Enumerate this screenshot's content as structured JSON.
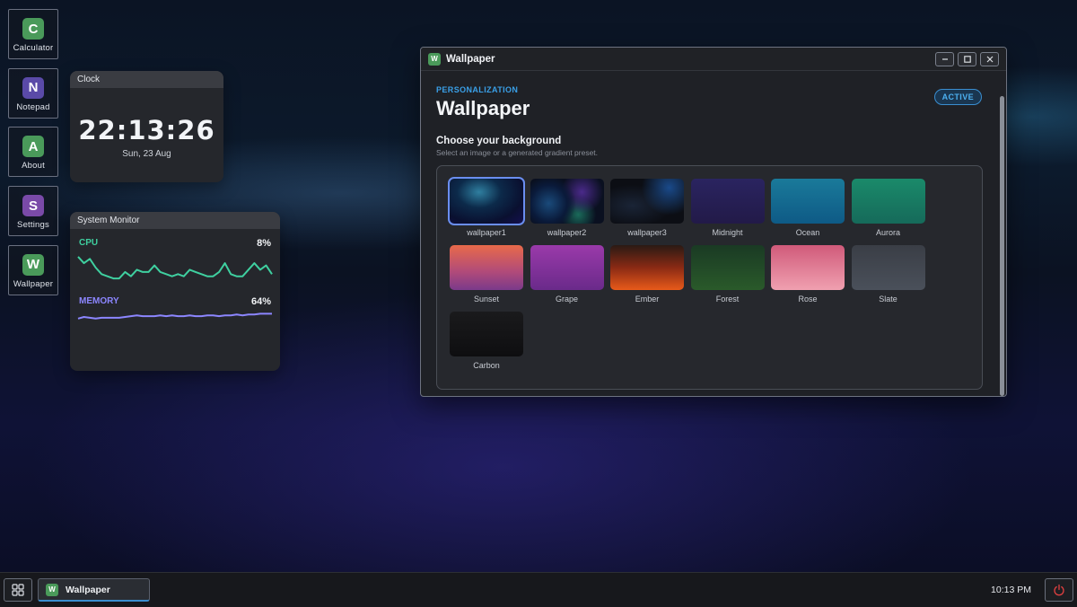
{
  "desktop": {
    "icons": [
      {
        "letter": "C",
        "label": "Calculator",
        "color": "#4a9a5a"
      },
      {
        "letter": "N",
        "label": "Notepad",
        "color": "#5a4aa8"
      },
      {
        "letter": "A",
        "label": "About",
        "color": "#4a9a5a"
      },
      {
        "letter": "S",
        "label": "Settings",
        "color": "#7a4aa8"
      },
      {
        "letter": "W",
        "label": "Wallpaper",
        "color": "#4a9a5a"
      }
    ]
  },
  "clock_widget": {
    "title": "Clock",
    "time": "22:13:26",
    "date": "Sun, 23 Aug"
  },
  "monitor_widget": {
    "title": "System Monitor",
    "cpu": {
      "label": "CPU",
      "value": "8%",
      "color": "#3fd0a0",
      "history": [
        12,
        9,
        11,
        7,
        4,
        3,
        2,
        2,
        5,
        3,
        6,
        5,
        5,
        8,
        5,
        4,
        3,
        4,
        3,
        6,
        5,
        4,
        3,
        3,
        5,
        9,
        4,
        3,
        3,
        6,
        9,
        6,
        8,
        4
      ]
    },
    "memory": {
      "label": "MEMORY",
      "value": "64%",
      "color": "#8c86ff",
      "history": [
        58,
        60,
        59,
        58,
        59,
        59,
        59,
        59,
        60,
        61,
        62,
        61,
        61,
        61,
        62,
        61,
        62,
        61,
        61,
        62,
        61,
        61,
        62,
        62,
        61,
        62,
        62,
        63,
        62,
        63,
        63,
        64,
        64,
        64
      ]
    }
  },
  "window": {
    "app_letter": "W",
    "title": "Wallpaper",
    "eyebrow": "PERSONALIZATION",
    "heading": "Wallpaper",
    "badge": "ACTIVE",
    "section_title": "Choose your background",
    "section_sub": "Select an image or a generated gradient preset.",
    "selected": "wallpaper1",
    "presets": [
      {
        "name": "wallpaper1",
        "bg": "radial-gradient(ellipse at 40% 30%, #2f7fa0 0%, #0c2a4a 35%, #0a1030 70%, #141050 100%)"
      },
      {
        "name": "wallpaper2",
        "bg": "radial-gradient(circle at 25% 55%, #1a4a7a 0%, #0a1a3a 30%, rgba(0,0,0,0) 45%), radial-gradient(circle at 70% 30%, #4a2a8a 0%, rgba(0,0,0,0) 35%), radial-gradient(circle at 65% 80%, #1a6a5a 0%, rgba(0,0,0,0) 30%), #0a1020"
      },
      {
        "name": "wallpaper3",
        "bg": "radial-gradient(circle at 80% 20%, #1a4a8a 0%, rgba(0,0,0,0) 40%), radial-gradient(ellipse at 30% 60%, #1a2436 0%, rgba(0,0,0,0) 55%), #0c0e14"
      },
      {
        "name": "Midnight",
        "bg": "linear-gradient(180deg, #2a2460 0%, #221a48 100%)"
      },
      {
        "name": "Ocean",
        "bg": "linear-gradient(180deg, #1a7a9a 0%, #0e5a86 100%)"
      },
      {
        "name": "Aurora",
        "bg": "linear-gradient(180deg, #1a8a6a 0%, #166a5a 100%)"
      },
      {
        "name": "Sunset",
        "bg": "linear-gradient(180deg, #e86a4a 0%, #b04a7a 60%, #7a3a8a 100%)"
      },
      {
        "name": "Grape",
        "bg": "linear-gradient(180deg, #9a3aaa 0%, #6a2a8a 100%)"
      },
      {
        "name": "Ember",
        "bg": "linear-gradient(180deg, #2a1a14 0%, #8a2a14 50%, #e85a1a 100%)"
      },
      {
        "name": "Forest",
        "bg": "linear-gradient(180deg, #1a3a24 0%, #2a5a2a 100%)"
      },
      {
        "name": "Rose",
        "bg": "linear-gradient(180deg, #d05a7a 0%, #f0a0b0 100%)"
      },
      {
        "name": "Slate",
        "bg": "linear-gradient(180deg, #3a3e46 0%, #4a505a 100%)"
      },
      {
        "name": "Carbon",
        "bg": "linear-gradient(180deg, #1a1a1c 0%, #0e0e10 100%)"
      }
    ]
  },
  "taskbar": {
    "task_letter": "W",
    "task_label": "Wallpaper",
    "time": "10:13 PM",
    "accent": "#3a8ed0",
    "power_color": "#e04040"
  }
}
